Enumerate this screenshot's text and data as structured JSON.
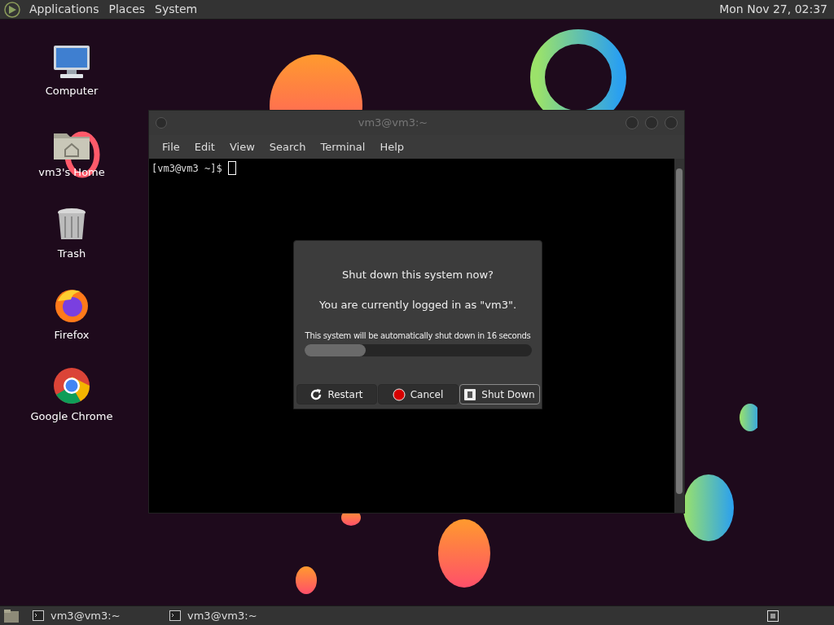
{
  "top_panel": {
    "menus": [
      "Applications",
      "Places",
      "System"
    ],
    "clock": "Mon Nov 27, 02:37"
  },
  "desktop_icons": [
    {
      "kind": "computer",
      "label": "Computer"
    },
    {
      "kind": "home",
      "label": "vm3's Home"
    },
    {
      "kind": "trash",
      "label": "Trash"
    },
    {
      "kind": "firefox",
      "label": "Firefox"
    },
    {
      "kind": "chrome",
      "label": "Google Chrome"
    }
  ],
  "terminal": {
    "title": "vm3@vm3:~",
    "menu": [
      "File",
      "Edit",
      "View",
      "Search",
      "Terminal",
      "Help"
    ],
    "prompt": "[vm3@vm3 ~]$"
  },
  "dialog": {
    "question": "Shut down this system now?",
    "info": "You are currently logged in as \"vm3\".",
    "countdown": "This system will be automatically shut down in 16 seconds",
    "level": 0.27,
    "buttons": [
      {
        "kind": "restart",
        "label": "Restart",
        "selected": false
      },
      {
        "kind": "cancel",
        "label": "Cancel",
        "selected": false
      },
      {
        "kind": "shutdown",
        "label": "Shut Down",
        "selected": true
      }
    ]
  },
  "taskbar": {
    "items": [
      "vm3@vm3:~",
      "vm3@vm3:~"
    ]
  }
}
